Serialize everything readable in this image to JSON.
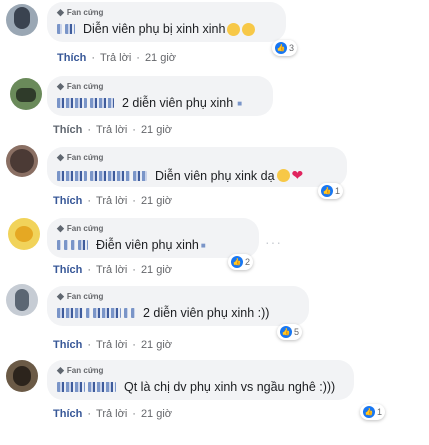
{
  "comments": [
    {
      "badge": "Fan cứng",
      "text": "Diễn viên phụ bị xinh xinh",
      "reactions": "3",
      "like": "Thích",
      "reply": "Trả lời",
      "time": "21 giờ"
    },
    {
      "badge": "Fan cứng",
      "text": "2 diễn viên phụ xinh",
      "reactions": "",
      "like": "Thích",
      "reply": "Trả lời",
      "time": "21 giờ"
    },
    {
      "badge": "Fan cứng",
      "text": "Diễn viên phụ xink dạ",
      "reactions": "1",
      "like": "Thích",
      "reply": "Trả lời",
      "time": "21 giờ"
    },
    {
      "badge": "Fan cứng",
      "text": "Điễn viên phụ xinh",
      "reactions": "2",
      "like": "Thích",
      "reply": "Trả lời",
      "time": "21 giờ"
    },
    {
      "badge": "Fan cứng",
      "text": "2 diễn viên phụ xinh :))",
      "reactions": "5",
      "like": "Thích",
      "reply": "Trả lời",
      "time": "21 giờ"
    },
    {
      "badge": "Fan cứng",
      "text": "Qt là chị dv phụ xinh vs ngầu nghê :)))",
      "reactions": "1",
      "like": "Thích",
      "reply": "Trả lời",
      "time": "21 giờ"
    }
  ],
  "colors": {
    "like_blue": "#1877f2",
    "link_blue": "#385898",
    "bubble": "#f2f3f5"
  }
}
